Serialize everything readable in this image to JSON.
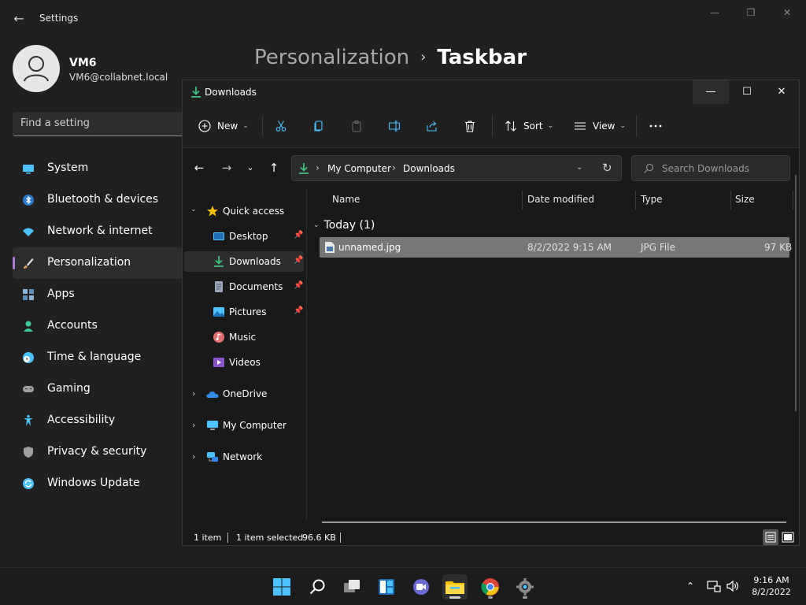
{
  "settings": {
    "title": "Settings",
    "user_name": "VM6",
    "user_email": "VM6@collabnet.local",
    "search_placeholder": "Find a setting",
    "nav": [
      {
        "label": "System",
        "icon": "monitor-icon",
        "color": "#4cc2ff"
      },
      {
        "label": "Bluetooth & devices",
        "icon": "bluetooth-icon",
        "color": "#4cc2ff"
      },
      {
        "label": "Network & internet",
        "icon": "wifi-icon",
        "color": "#4cc2ff"
      },
      {
        "label": "Personalization",
        "icon": "brush-icon",
        "color": "#e0a060",
        "active": true
      },
      {
        "label": "Apps",
        "icon": "apps-icon",
        "color": "#8ab4d8"
      },
      {
        "label": "Accounts",
        "icon": "person-icon",
        "color": "#3ccb9a"
      },
      {
        "label": "Time & language",
        "icon": "globe-clock-icon",
        "color": "#4cc2ff"
      },
      {
        "label": "Gaming",
        "icon": "gamepad-icon",
        "color": "#a0a0a0"
      },
      {
        "label": "Accessibility",
        "icon": "accessibility-icon",
        "color": "#4cc2ff"
      },
      {
        "label": "Privacy & security",
        "icon": "shield-icon",
        "color": "#a0a0a0"
      },
      {
        "label": "Windows Update",
        "icon": "update-icon",
        "color": "#4cc2ff"
      }
    ],
    "breadcrumb_parent": "Personalization",
    "breadcrumb_sep": "›",
    "breadcrumb_current": "Taskbar"
  },
  "explorer": {
    "title": "Downloads",
    "toolbar": {
      "new_label": "New",
      "sort_label": "Sort",
      "view_label": "View"
    },
    "address": {
      "path": [
        "My Computer",
        "Downloads"
      ]
    },
    "search_placeholder": "Search Downloads",
    "sidebar": [
      {
        "label": "Quick access",
        "icon": "star-icon",
        "level": 0,
        "expanded": true
      },
      {
        "label": "Desktop",
        "icon": "desktop-folder-icon",
        "level": 1,
        "pinned": true
      },
      {
        "label": "Downloads",
        "icon": "download-icon",
        "level": 1,
        "pinned": true,
        "selected": true
      },
      {
        "label": "Documents",
        "icon": "documents-icon",
        "level": 1,
        "pinned": true
      },
      {
        "label": "Pictures",
        "icon": "pictures-icon",
        "level": 1,
        "pinned": true
      },
      {
        "label": "Music",
        "icon": "music-icon",
        "level": 1
      },
      {
        "label": "Videos",
        "icon": "videos-icon",
        "level": 1
      },
      {
        "label": "OneDrive",
        "icon": "cloud-icon",
        "level": 0,
        "expanded": false
      },
      {
        "label": "My Computer",
        "icon": "computer-icon",
        "level": 0,
        "expanded": false
      },
      {
        "label": "Network",
        "icon": "network-icon",
        "level": 0,
        "expanded": false
      }
    ],
    "columns": [
      "Name",
      "Date modified",
      "Type",
      "Size"
    ],
    "group_label": "Today (1)",
    "files": [
      {
        "name": "unnamed.jpg",
        "date": "8/2/2022 9:15 AM",
        "type": "JPG File",
        "size": "97 KB"
      }
    ],
    "status": {
      "count": "1 item",
      "selected": "1 item selected",
      "size": "96.6 KB"
    }
  },
  "taskbar": {
    "apps": [
      "start-icon",
      "search-icon",
      "task-view-icon",
      "widgets-icon",
      "chat-icon",
      "file-explorer-icon",
      "chrome-icon",
      "settings-gear-icon"
    ],
    "time": "9:16 AM",
    "date": "8/2/2022"
  },
  "colors": {
    "accent_blue": "#4cc2ff",
    "download_green": "#3fbf7f",
    "selection_gray": "#777777",
    "nav_indicator": "#a979d8"
  }
}
